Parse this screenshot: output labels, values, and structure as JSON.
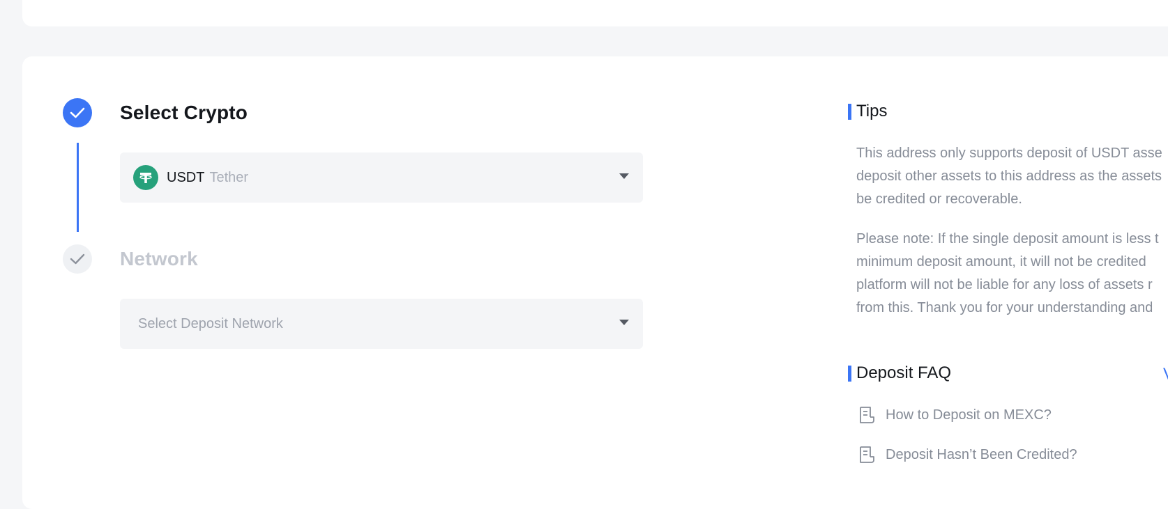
{
  "steps": [
    {
      "title": "Select Crypto",
      "state": "completed"
    },
    {
      "title": "Network",
      "state": "pending"
    }
  ],
  "crypto_select": {
    "symbol": "USDT",
    "name": "Tether",
    "logo_color": "#26a17b"
  },
  "network_select": {
    "placeholder": "Select Deposit Network"
  },
  "tips": {
    "title": "Tips",
    "paragraph1": [
      "This address only supports deposit of USDT asse",
      "deposit other assets to this address as the assets",
      "be credited or recoverable."
    ],
    "paragraph2": [
      "Please note: If the single deposit amount is less t",
      "minimum deposit amount, it will not be credited",
      "platform will not be liable for any loss of assets r",
      "from this. Thank you for your understanding and"
    ]
  },
  "faq": {
    "title": "Deposit FAQ",
    "view_more": "V",
    "items": [
      "How to Deposit on MEXC?",
      "Deposit Hasn’t Been Credited?"
    ]
  },
  "colors": {
    "accent": "#3b75f5",
    "inactive": "#c3c7cf"
  }
}
